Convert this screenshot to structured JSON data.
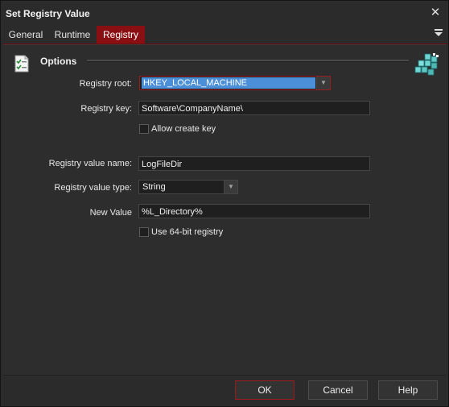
{
  "window": {
    "title": "Set Registry Value",
    "close_icon": "close-icon"
  },
  "tabs": [
    {
      "label": "General"
    },
    {
      "label": "Runtime"
    },
    {
      "label": "Registry",
      "active": true
    }
  ],
  "section": {
    "title": "Options"
  },
  "form": {
    "registry_root": {
      "label": "Registry root:",
      "value": "HKEY_LOCAL_MACHINE"
    },
    "registry_key": {
      "label": "Registry key:",
      "value": "Software\\CompanyName\\"
    },
    "allow_create_key": {
      "label": "Allow create key",
      "checked": false
    },
    "value_name": {
      "label": "Registry value name:",
      "value": "LogFileDir"
    },
    "value_type": {
      "label": "Registry value type:",
      "value": "String"
    },
    "new_value": {
      "label": "New Value",
      "value": "%L_Directory%"
    },
    "use_64bit": {
      "label": "Use 64-bit registry",
      "checked": false
    }
  },
  "buttons": {
    "ok": "OK",
    "cancel": "Cancel",
    "help": "Help"
  },
  "colors": {
    "accent": "#8a0f12",
    "selection": "#4a8fd8",
    "background": "#2b2b2b"
  }
}
